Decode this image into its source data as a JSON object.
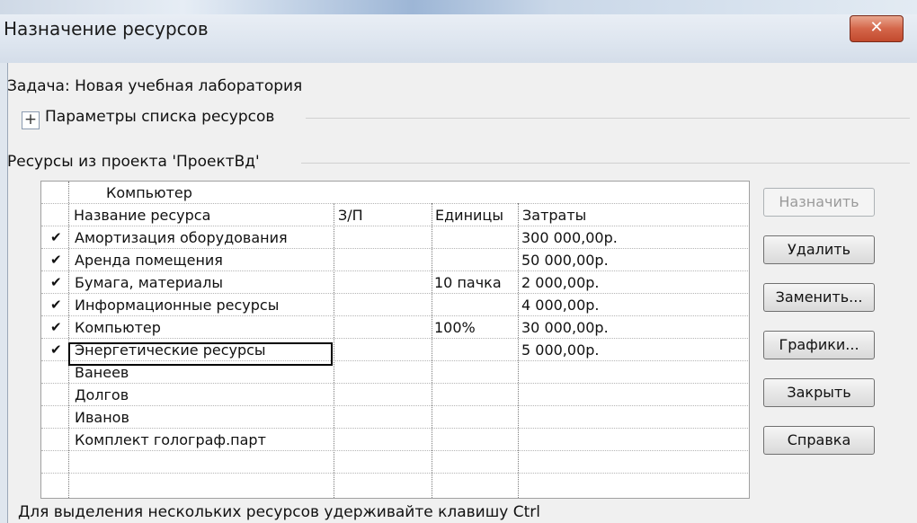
{
  "window": {
    "title": "Назначение ресурсов",
    "close_glyph": "✕"
  },
  "task": {
    "label": "Задача: Новая учебная лаборатория"
  },
  "options_toggle": {
    "symbol": "+",
    "label": "Параметры списка ресурсов"
  },
  "resources_group": {
    "label": "Ресурсы из проекта 'ПроектВд'"
  },
  "grid": {
    "edit_value": "Компьютер",
    "headers": [
      "Название ресурса",
      "З/П",
      "Единицы",
      "Затраты"
    ],
    "rows": [
      {
        "check": "✔",
        "name": "Амортизация оборудования",
        "rd": "",
        "units": "",
        "cost": "300 000,00р."
      },
      {
        "check": "✔",
        "name": "Аренда помещения",
        "rd": "",
        "units": "",
        "cost": "50 000,00р."
      },
      {
        "check": "✔",
        "name": "Бумага, материалы",
        "rd": "",
        "units": "10 пачка",
        "cost": "2 000,00р."
      },
      {
        "check": "✔",
        "name": "Информационные ресурсы",
        "rd": "",
        "units": "",
        "cost": "4 000,00р."
      },
      {
        "check": "✔",
        "name": "Компьютер",
        "rd": "",
        "units": "100%",
        "cost": "30 000,00р."
      },
      {
        "check": "✔",
        "name": "Энергетические ресурсы",
        "rd": "",
        "units": "",
        "cost": "5 000,00р."
      },
      {
        "check": "",
        "name": "Ванеев",
        "rd": "",
        "units": "",
        "cost": ""
      },
      {
        "check": "",
        "name": "Долгов",
        "rd": "",
        "units": "",
        "cost": ""
      },
      {
        "check": "",
        "name": "Иванов",
        "rd": "",
        "units": "",
        "cost": ""
      },
      {
        "check": "",
        "name": "Комплект голограф.парт",
        "rd": "",
        "units": "",
        "cost": ""
      }
    ]
  },
  "buttons": {
    "assign": "Назначить",
    "remove": "Удалить",
    "replace": "Заменить...",
    "graphs": "Графики...",
    "close": "Закрыть",
    "help": "Справка"
  },
  "footer": {
    "hint": "Для выделения нескольких ресурсов удерживайте клавишу Ctrl"
  }
}
